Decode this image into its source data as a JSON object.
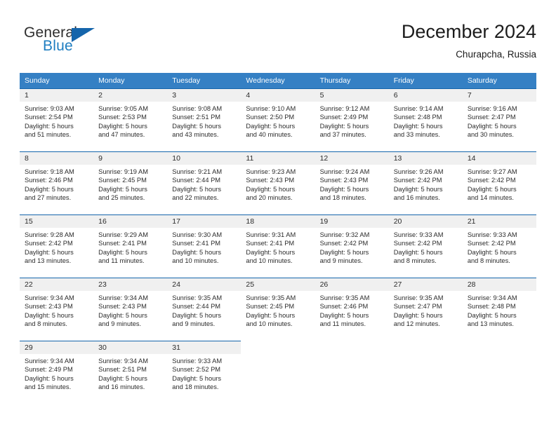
{
  "brand": {
    "name_part1": "General",
    "name_part2": "Blue",
    "flag_icon": "triangle-flag-icon"
  },
  "header": {
    "title": "December 2024",
    "location": "Churapcha, Russia"
  },
  "colors": {
    "header_blue": "#3580c4",
    "cell_rule_blue": "#1565ab",
    "daynum_bg": "#f0f0f0",
    "brand_blue": "#1f7ec1",
    "text": "#2b2b2b"
  },
  "weekday_headers": [
    "Sunday",
    "Monday",
    "Tuesday",
    "Wednesday",
    "Thursday",
    "Friday",
    "Saturday"
  ],
  "weeks": [
    [
      {
        "day": "1",
        "sunrise": "Sunrise: 9:03 AM",
        "sunset": "Sunset: 2:54 PM",
        "daylight_line1": "Daylight: 5 hours",
        "daylight_line2": "and 51 minutes."
      },
      {
        "day": "2",
        "sunrise": "Sunrise: 9:05 AM",
        "sunset": "Sunset: 2:53 PM",
        "daylight_line1": "Daylight: 5 hours",
        "daylight_line2": "and 47 minutes."
      },
      {
        "day": "3",
        "sunrise": "Sunrise: 9:08 AM",
        "sunset": "Sunset: 2:51 PM",
        "daylight_line1": "Daylight: 5 hours",
        "daylight_line2": "and 43 minutes."
      },
      {
        "day": "4",
        "sunrise": "Sunrise: 9:10 AM",
        "sunset": "Sunset: 2:50 PM",
        "daylight_line1": "Daylight: 5 hours",
        "daylight_line2": "and 40 minutes."
      },
      {
        "day": "5",
        "sunrise": "Sunrise: 9:12 AM",
        "sunset": "Sunset: 2:49 PM",
        "daylight_line1": "Daylight: 5 hours",
        "daylight_line2": "and 37 minutes."
      },
      {
        "day": "6",
        "sunrise": "Sunrise: 9:14 AM",
        "sunset": "Sunset: 2:48 PM",
        "daylight_line1": "Daylight: 5 hours",
        "daylight_line2": "and 33 minutes."
      },
      {
        "day": "7",
        "sunrise": "Sunrise: 9:16 AM",
        "sunset": "Sunset: 2:47 PM",
        "daylight_line1": "Daylight: 5 hours",
        "daylight_line2": "and 30 minutes."
      }
    ],
    [
      {
        "day": "8",
        "sunrise": "Sunrise: 9:18 AM",
        "sunset": "Sunset: 2:46 PM",
        "daylight_line1": "Daylight: 5 hours",
        "daylight_line2": "and 27 minutes."
      },
      {
        "day": "9",
        "sunrise": "Sunrise: 9:19 AM",
        "sunset": "Sunset: 2:45 PM",
        "daylight_line1": "Daylight: 5 hours",
        "daylight_line2": "and 25 minutes."
      },
      {
        "day": "10",
        "sunrise": "Sunrise: 9:21 AM",
        "sunset": "Sunset: 2:44 PM",
        "daylight_line1": "Daylight: 5 hours",
        "daylight_line2": "and 22 minutes."
      },
      {
        "day": "11",
        "sunrise": "Sunrise: 9:23 AM",
        "sunset": "Sunset: 2:43 PM",
        "daylight_line1": "Daylight: 5 hours",
        "daylight_line2": "and 20 minutes."
      },
      {
        "day": "12",
        "sunrise": "Sunrise: 9:24 AM",
        "sunset": "Sunset: 2:43 PM",
        "daylight_line1": "Daylight: 5 hours",
        "daylight_line2": "and 18 minutes."
      },
      {
        "day": "13",
        "sunrise": "Sunrise: 9:26 AM",
        "sunset": "Sunset: 2:42 PM",
        "daylight_line1": "Daylight: 5 hours",
        "daylight_line2": "and 16 minutes."
      },
      {
        "day": "14",
        "sunrise": "Sunrise: 9:27 AM",
        "sunset": "Sunset: 2:42 PM",
        "daylight_line1": "Daylight: 5 hours",
        "daylight_line2": "and 14 minutes."
      }
    ],
    [
      {
        "day": "15",
        "sunrise": "Sunrise: 9:28 AM",
        "sunset": "Sunset: 2:42 PM",
        "daylight_line1": "Daylight: 5 hours",
        "daylight_line2": "and 13 minutes."
      },
      {
        "day": "16",
        "sunrise": "Sunrise: 9:29 AM",
        "sunset": "Sunset: 2:41 PM",
        "daylight_line1": "Daylight: 5 hours",
        "daylight_line2": "and 11 minutes."
      },
      {
        "day": "17",
        "sunrise": "Sunrise: 9:30 AM",
        "sunset": "Sunset: 2:41 PM",
        "daylight_line1": "Daylight: 5 hours",
        "daylight_line2": "and 10 minutes."
      },
      {
        "day": "18",
        "sunrise": "Sunrise: 9:31 AM",
        "sunset": "Sunset: 2:41 PM",
        "daylight_line1": "Daylight: 5 hours",
        "daylight_line2": "and 10 minutes."
      },
      {
        "day": "19",
        "sunrise": "Sunrise: 9:32 AM",
        "sunset": "Sunset: 2:42 PM",
        "daylight_line1": "Daylight: 5 hours",
        "daylight_line2": "and 9 minutes."
      },
      {
        "day": "20",
        "sunrise": "Sunrise: 9:33 AM",
        "sunset": "Sunset: 2:42 PM",
        "daylight_line1": "Daylight: 5 hours",
        "daylight_line2": "and 8 minutes."
      },
      {
        "day": "21",
        "sunrise": "Sunrise: 9:33 AM",
        "sunset": "Sunset: 2:42 PM",
        "daylight_line1": "Daylight: 5 hours",
        "daylight_line2": "and 8 minutes."
      }
    ],
    [
      {
        "day": "22",
        "sunrise": "Sunrise: 9:34 AM",
        "sunset": "Sunset: 2:43 PM",
        "daylight_line1": "Daylight: 5 hours",
        "daylight_line2": "and 8 minutes."
      },
      {
        "day": "23",
        "sunrise": "Sunrise: 9:34 AM",
        "sunset": "Sunset: 2:43 PM",
        "daylight_line1": "Daylight: 5 hours",
        "daylight_line2": "and 9 minutes."
      },
      {
        "day": "24",
        "sunrise": "Sunrise: 9:35 AM",
        "sunset": "Sunset: 2:44 PM",
        "daylight_line1": "Daylight: 5 hours",
        "daylight_line2": "and 9 minutes."
      },
      {
        "day": "25",
        "sunrise": "Sunrise: 9:35 AM",
        "sunset": "Sunset: 2:45 PM",
        "daylight_line1": "Daylight: 5 hours",
        "daylight_line2": "and 10 minutes."
      },
      {
        "day": "26",
        "sunrise": "Sunrise: 9:35 AM",
        "sunset": "Sunset: 2:46 PM",
        "daylight_line1": "Daylight: 5 hours",
        "daylight_line2": "and 11 minutes."
      },
      {
        "day": "27",
        "sunrise": "Sunrise: 9:35 AM",
        "sunset": "Sunset: 2:47 PM",
        "daylight_line1": "Daylight: 5 hours",
        "daylight_line2": "and 12 minutes."
      },
      {
        "day": "28",
        "sunrise": "Sunrise: 9:34 AM",
        "sunset": "Sunset: 2:48 PM",
        "daylight_line1": "Daylight: 5 hours",
        "daylight_line2": "and 13 minutes."
      }
    ],
    [
      {
        "day": "29",
        "sunrise": "Sunrise: 9:34 AM",
        "sunset": "Sunset: 2:49 PM",
        "daylight_line1": "Daylight: 5 hours",
        "daylight_line2": "and 15 minutes."
      },
      {
        "day": "30",
        "sunrise": "Sunrise: 9:34 AM",
        "sunset": "Sunset: 2:51 PM",
        "daylight_line1": "Daylight: 5 hours",
        "daylight_line2": "and 16 minutes."
      },
      {
        "day": "31",
        "sunrise": "Sunrise: 9:33 AM",
        "sunset": "Sunset: 2:52 PM",
        "daylight_line1": "Daylight: 5 hours",
        "daylight_line2": "and 18 minutes."
      },
      {
        "day": "",
        "sunrise": "",
        "sunset": "",
        "daylight_line1": "",
        "daylight_line2": ""
      },
      {
        "day": "",
        "sunrise": "",
        "sunset": "",
        "daylight_line1": "",
        "daylight_line2": ""
      },
      {
        "day": "",
        "sunrise": "",
        "sunset": "",
        "daylight_line1": "",
        "daylight_line2": ""
      },
      {
        "day": "",
        "sunrise": "",
        "sunset": "",
        "daylight_line1": "",
        "daylight_line2": ""
      }
    ]
  ]
}
